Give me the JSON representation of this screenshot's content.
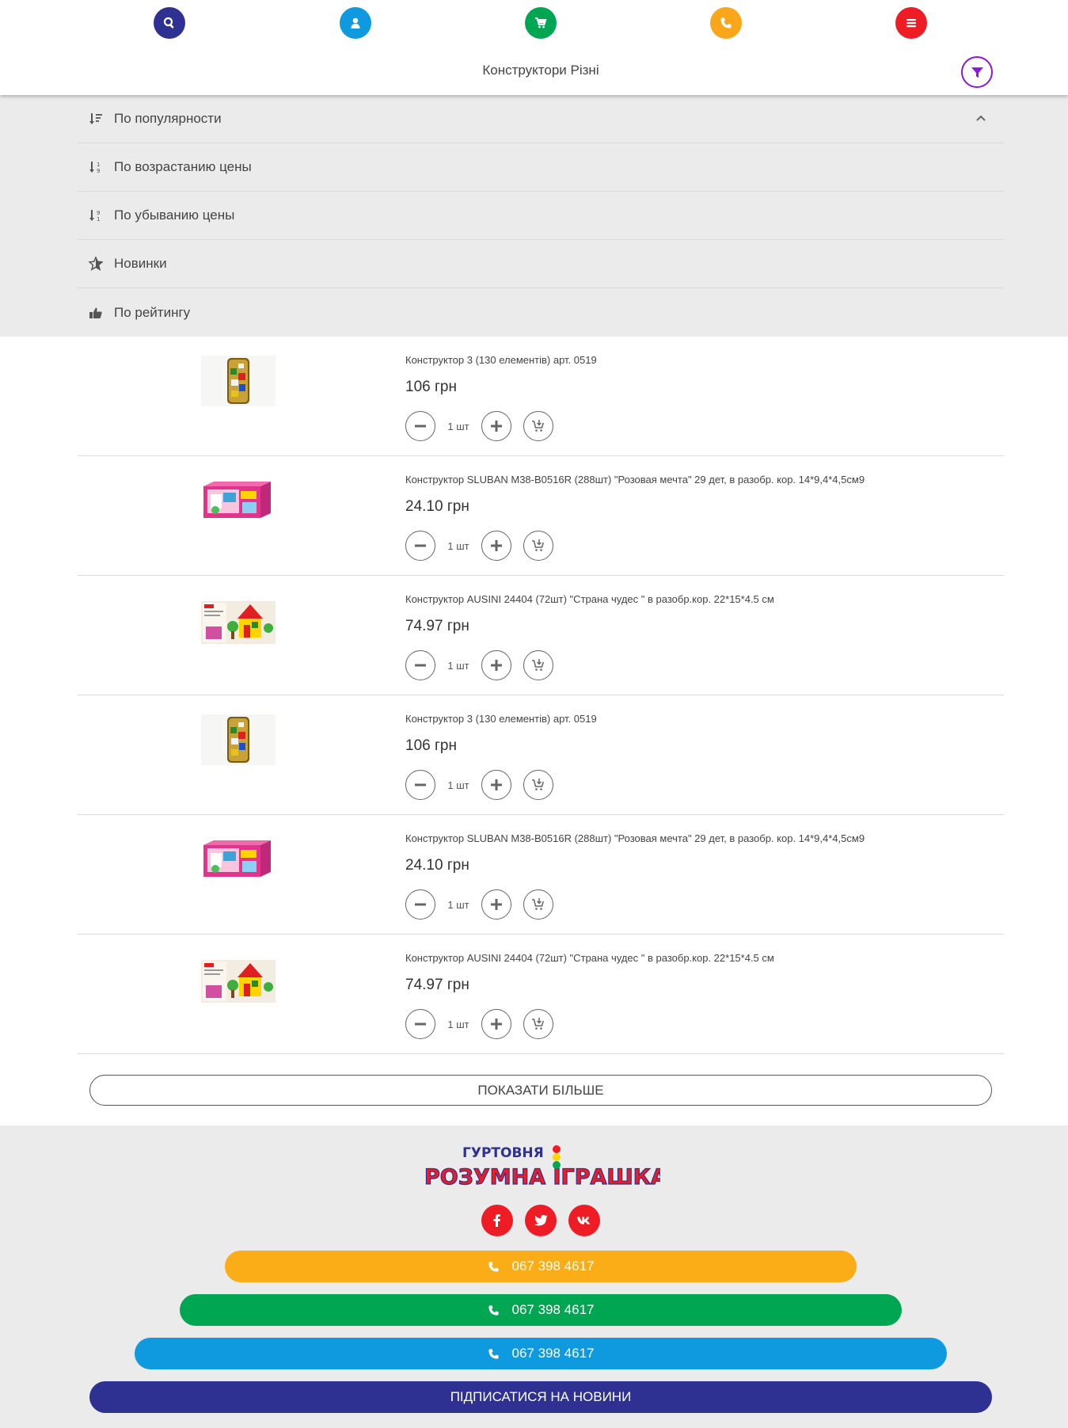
{
  "header": {
    "title": "Конструктори Різні",
    "icons": [
      {
        "name": "search-icon",
        "color": "#2e3192"
      },
      {
        "name": "user-icon",
        "color": "#0f9ae0"
      },
      {
        "name": "cart-icon",
        "color": "#00a651"
      },
      {
        "name": "phone-icon",
        "color": "#f9a61a"
      },
      {
        "name": "menu-icon",
        "color": "#ee1c25"
      }
    ],
    "filter_icon": "filter-icon",
    "filter_color": "#8a18d8"
  },
  "sort": {
    "items": [
      {
        "label": "По популярности",
        "icon": "sort-popularity-icon"
      },
      {
        "label": "По возрастанию цены",
        "icon": "sort-ascending-icon"
      },
      {
        "label": "По убыванию цены",
        "icon": "sort-descending-icon"
      },
      {
        "label": "Новинки",
        "icon": "star-icon"
      },
      {
        "label": "По рейтингу",
        "icon": "thumbs-up-icon"
      }
    ]
  },
  "products": [
    {
      "name": "Конструктор 3 (130 елементів) арт. 0519",
      "price": "106 грн",
      "qty": "1 шт",
      "image": "tube"
    },
    {
      "name": "Конструктор SLUBAN M38-B0516R (288шт) \"Розовая мечта\" 29 дет, в разобр. кор. 14*9,4*4,5см9",
      "price": "24.10 грн",
      "qty": "1 шт",
      "image": "pinkbox"
    },
    {
      "name": "Конструктор AUSINI 24404 (72шт) \"Страна чудес \" в разобр.кор. 22*15*4.5 см",
      "price": "74.97 грн",
      "qty": "1 шт",
      "image": "house"
    },
    {
      "name": "Конструктор 3 (130 елементів) арт. 0519",
      "price": "106 грн",
      "qty": "1 шт",
      "image": "tube"
    },
    {
      "name": "Конструктор SLUBAN M38-B0516R (288шт) \"Розовая мечта\" 29 дет, в разобр. кор. 14*9,4*4,5см9",
      "price": "24.10 грн",
      "qty": "1 шт",
      "image": "pinkbox"
    },
    {
      "name": "Конструктор AUSINI 24404 (72шт) \"Страна чудес \" в разобр.кор. 22*15*4.5 см",
      "price": "74.97 грн",
      "qty": "1 шт",
      "image": "house"
    }
  ],
  "more_button": "ПОКАЗАТИ БІЛЬШЕ",
  "footer": {
    "logo_top": "ГУРТОВНЯ",
    "logo_main": "РОЗУМНА ІГРАШКА",
    "social": [
      "facebook-icon",
      "twitter-icon",
      "vk-icon"
    ],
    "phones": [
      {
        "number": "067 398 4617",
        "color": "#fbad18"
      },
      {
        "number": "067 398 4617",
        "color": "#00a651"
      },
      {
        "number": "067 398 4617",
        "color": "#0f9ae0"
      }
    ],
    "subscribe": "ПІДПИСАТИСЯ НА НОВИНИ",
    "subscribe_color": "#2e3192"
  }
}
